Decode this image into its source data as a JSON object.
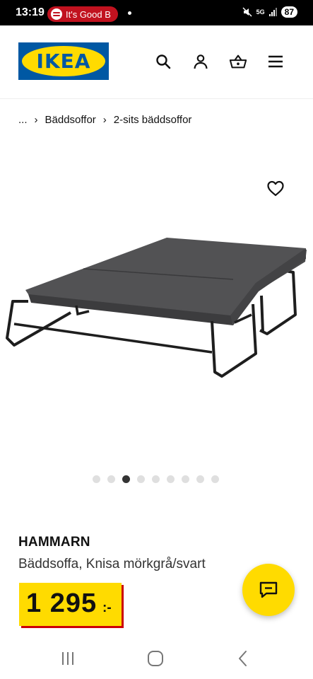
{
  "status_bar": {
    "time": "13:19",
    "now_playing": "It's Good B",
    "network": "5G",
    "battery": "87"
  },
  "header": {
    "logo_text": "IKEA",
    "brand_blue": "#0058a3",
    "brand_yellow": "#ffdb00",
    "icons": [
      "search-icon",
      "account-icon",
      "basket-icon",
      "menu-icon"
    ]
  },
  "breadcrumb": {
    "ellipsis": "...",
    "items": [
      "Bäddsoffor",
      "2-sits bäddsoffor"
    ]
  },
  "carousel": {
    "total": 9,
    "active_index": 2
  },
  "product": {
    "name": "HAMMARN",
    "description": "Bäddsoffa, Knisa mörkgrå/svart",
    "price": "1 295",
    "price_suffix": ":-"
  },
  "nav": {
    "buttons": [
      "recent-apps-icon",
      "home-icon",
      "back-icon"
    ]
  }
}
